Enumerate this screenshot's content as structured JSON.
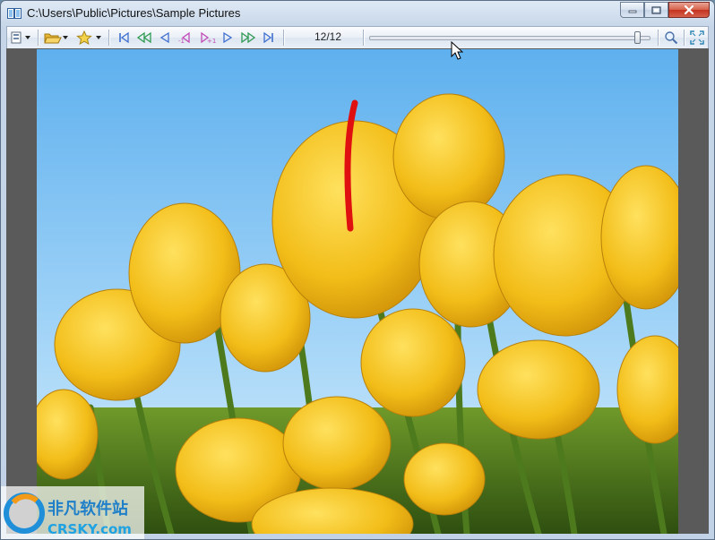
{
  "window": {
    "title": "C:\\Users\\Public\\Pictures\\Sample Pictures"
  },
  "toolbar": {
    "counter": "12/12",
    "slider_fraction": 0.97
  },
  "colors": {
    "sky": "#6ab4ec",
    "tulip": "#f2c01c",
    "stem": "#4e7a1e",
    "viewer_bg": "#5a5a5a"
  },
  "watermark": {
    "cn_text": "非凡软件站",
    "en_text": "CRSKY.com"
  }
}
